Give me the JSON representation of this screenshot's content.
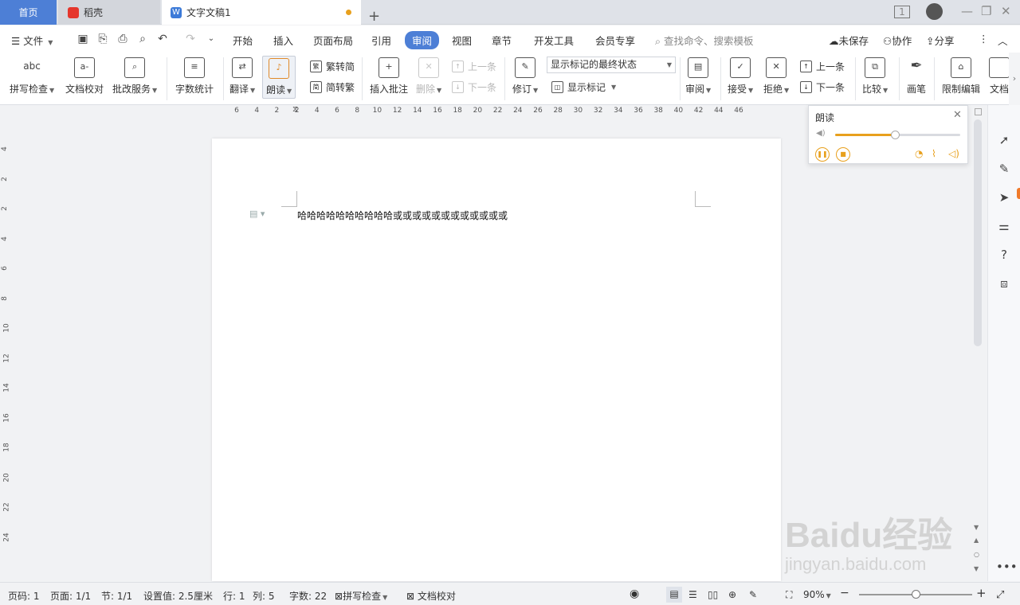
{
  "tabs": {
    "home": "首页",
    "shell": "稻壳",
    "doc": "文字文稿1"
  },
  "menu": {
    "file": "文件",
    "items": [
      "开始",
      "插入",
      "页面布局",
      "引用",
      "审阅",
      "视图",
      "章节",
      "开发工具",
      "会员专享"
    ],
    "active": "审阅",
    "search_placeholder": "查找命令、搜索模板",
    "unsaved": "未保存",
    "collab": "协作",
    "share": "分享"
  },
  "ribbon": {
    "spellcheck": "拼写检查",
    "proofread": "文档校对",
    "review_service": "批改服务",
    "word_count": "字数统计",
    "translate": "翻译",
    "read_aloud": "朗读",
    "to_traditional": "繁转简",
    "to_simplified": "简转繁",
    "insert_comment": "插入批注",
    "delete": "删除",
    "prev_item": "上一条",
    "next_item": "下一条",
    "track_changes": "修订",
    "markup_select": "显示标记的最终状态",
    "show_markup": "显示标记",
    "review_pane": "审阅",
    "accept": "接受",
    "reject": "拒绝",
    "prev_change": "上一条",
    "next_change": "下一条",
    "compare": "比较",
    "ink": "画笔",
    "restrict_edit": "限制编辑",
    "doc_more": "文档"
  },
  "ruler": {
    "h_ticks": [
      "6",
      "4",
      "2",
      "2",
      "4",
      "6",
      "8",
      "10",
      "12",
      "14",
      "16",
      "18",
      "20",
      "22",
      "24",
      "26",
      "28",
      "30",
      "32",
      "34",
      "36",
      "38",
      "40",
      "42",
      "44",
      "46"
    ],
    "v_ticks": [
      "4",
      "2",
      "2",
      "4",
      "6",
      "8",
      "10",
      "12",
      "14",
      "16",
      "18",
      "20",
      "22",
      "24"
    ]
  },
  "document": {
    "text": "哈哈哈哈哈哈哈哈哈哈或或或或或或或或或或或或"
  },
  "read_panel": {
    "title": "朗读",
    "volume": 0.48
  },
  "status": {
    "page_num": "页码: 1",
    "pages": "页面: 1/1",
    "section": "节: 1/1",
    "setting": "设置值: 2.5厘米",
    "row": "行: 1",
    "col": "列: 5",
    "words": "字数: 22",
    "spell": "拼写检查",
    "proof": "文档校对",
    "zoom": "90%",
    "zoom_level": 0.5
  },
  "watermark": {
    "line1": "Baidu经验",
    "line2": "jingyan.baidu.com"
  },
  "colors": {
    "accent": "#4d7fd6",
    "brand_red": "#e5362c",
    "orange": "#e8a01d"
  }
}
